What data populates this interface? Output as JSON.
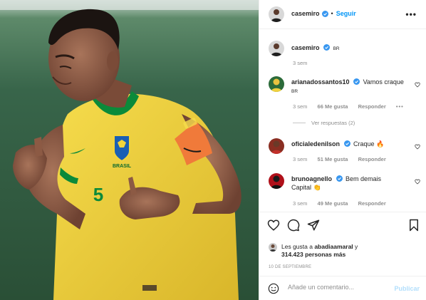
{
  "header": {
    "username": "casemiro",
    "separator": "•",
    "follow_label": "Seguir",
    "more_label": "•••"
  },
  "caption": {
    "username": "casemiro",
    "text": "BR",
    "time": "3 sem"
  },
  "comments": [
    {
      "username": "arianadossantos10",
      "text": "Vamos craque",
      "text2": "BR",
      "time": "3 sem",
      "likes": "66 Me gusta",
      "reply": "Responder",
      "more": "•••",
      "view_replies": "Ver respuestas (2)"
    },
    {
      "username": "oficialedenilson",
      "text": "Craque 🔥",
      "time": "3 sem",
      "likes": "51 Me gusta",
      "reply": "Responder"
    },
    {
      "username": "brunoagnello",
      "text": "Bem demais",
      "text2": "Capital 👏",
      "time": "3 sem",
      "likes": "49 Me gusta",
      "reply": "Responder"
    }
  ],
  "likes": {
    "prefix": "Les gusta a",
    "first_user": "abadiaamaral",
    "joiner": "y",
    "count": "314.423 personas más"
  },
  "date": "10 DE SEPTIEMBRE",
  "add_comment": {
    "placeholder": "Añade un comentario...",
    "publish_label": "Publicar"
  },
  "photo": {
    "shirt_number": "5",
    "crest_text": "BRASIL"
  },
  "colors": {
    "accent": "#0095f6",
    "verified": "#3897f0",
    "muted": "#8e8e8e",
    "jersey": "#f4d03f",
    "jersey_trim": "#0b8a3a",
    "armband": "#f07a3a",
    "pitch": "#2e5a38"
  }
}
